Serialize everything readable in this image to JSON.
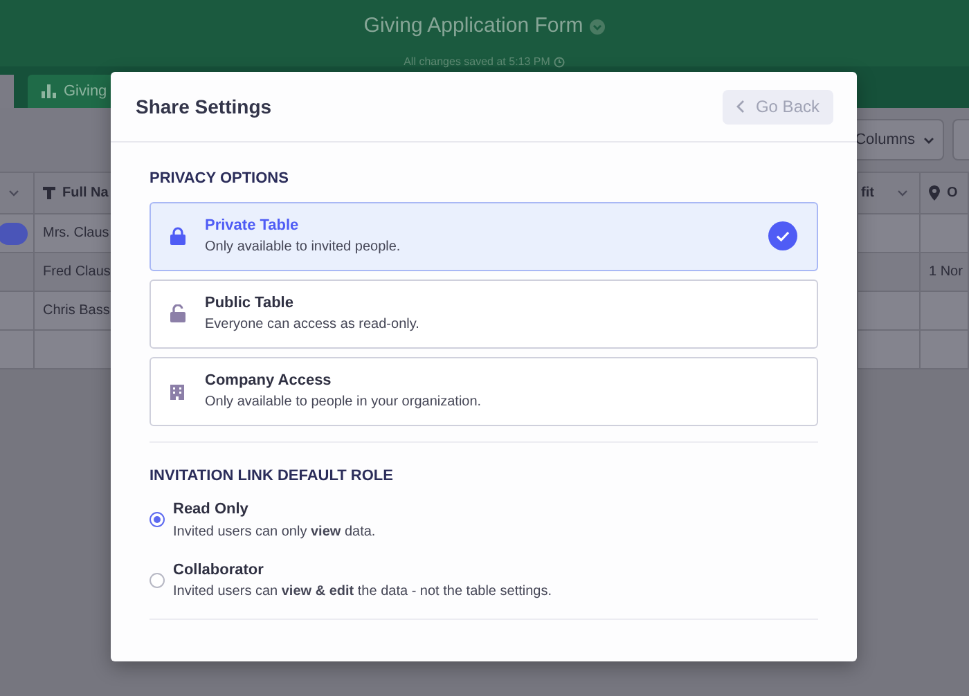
{
  "app": {
    "title": "Giving Application Form",
    "save_status": "All changes saved at 5:13 PM",
    "tabs": [
      {
        "label": "Giving",
        "selected": true
      }
    ],
    "columns_button": "Columns",
    "table": {
      "columns": [
        {
          "kind": "text",
          "label": "Full Na"
        },
        {
          "kind": "menu",
          "label": "fit"
        },
        {
          "kind": "location",
          "label": "O"
        }
      ],
      "rows": [
        [
          "Mrs. Claus",
          "",
          ""
        ],
        [
          "Fred Claus",
          "",
          "1 Nor"
        ],
        [
          "Chris Bass",
          "",
          ""
        ]
      ]
    }
  },
  "modal": {
    "title": "Share Settings",
    "back_button": "Go Back",
    "privacy_heading": "PRIVACY OPTIONS",
    "privacy_options": [
      {
        "kind": "private",
        "title": "Private Table",
        "description": "Only available to invited people.",
        "selected": true
      },
      {
        "kind": "public",
        "title": "Public Table",
        "description": "Everyone can access as read-only.",
        "selected": false
      },
      {
        "kind": "company",
        "title": "Company Access",
        "description": "Only available to people in your organization.",
        "selected": false
      }
    ],
    "role_heading": "INVITATION LINK DEFAULT ROLE",
    "roles": [
      {
        "title": "Read Only",
        "description": "Invited users can only **view** data.",
        "selected": true
      },
      {
        "title": "Collaborator",
        "description": "Invited users can **view & edit** the data - not the table settings.",
        "selected": false
      }
    ]
  }
}
